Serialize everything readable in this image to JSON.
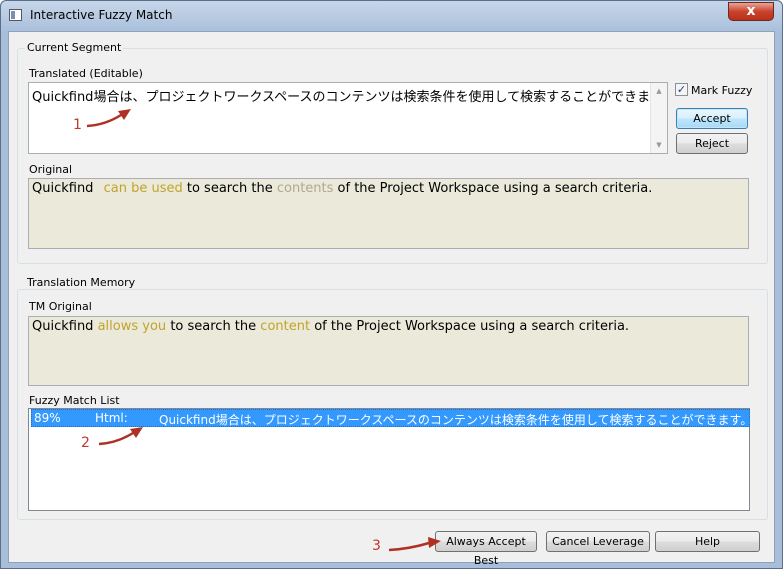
{
  "window": {
    "title": "Interactive Fuzzy Match",
    "close_glyph": "x"
  },
  "current_segment": {
    "group_label": "Current Segment",
    "translated_label": "Translated (Editable)",
    "translated_text": "Quickfind場合は、プロジェクトワークスペースのコンテンツは検索条件を使用して検索することができます。",
    "original_label": "Original",
    "original_parts": {
      "p1": "Quickfind",
      "p2": "can be used",
      "p3": "to search the",
      "p4": "contents",
      "p5": "of the Project Workspace using a search criteria."
    },
    "mark_fuzzy_label": "Mark Fuzzy",
    "mark_fuzzy_checked": true,
    "accept_label": "Accept",
    "reject_label": "Reject"
  },
  "translation_memory": {
    "group_label": "Translation Memory",
    "tm_original_label": "TM Original",
    "tm_original_parts": {
      "p1": "Quickfind",
      "p2": "allows you",
      "p3": "to search the",
      "p4": "content",
      "p5": "of the Project Workspace using a search criteria."
    },
    "fuzzy_list_label": "Fuzzy Match List",
    "fuzzy_rows": [
      {
        "percent": "89%",
        "type": "Html:",
        "text": "Quickfind場合は、プロジェクトワークスペースのコンテンツは検索条件を使用して検索することができます。"
      }
    ]
  },
  "buttons": {
    "always_accept_best": "Always Accept Best",
    "cancel_leverage": "Cancel Leverage",
    "help": "Help"
  },
  "annotations": {
    "n1": "1",
    "n2": "2",
    "n3": "3"
  },
  "colors": {
    "highlight_match": "#c2a32c",
    "highlight_diff": "#b2a890",
    "selection": "#3399ff",
    "annotation": "#c0392b"
  }
}
